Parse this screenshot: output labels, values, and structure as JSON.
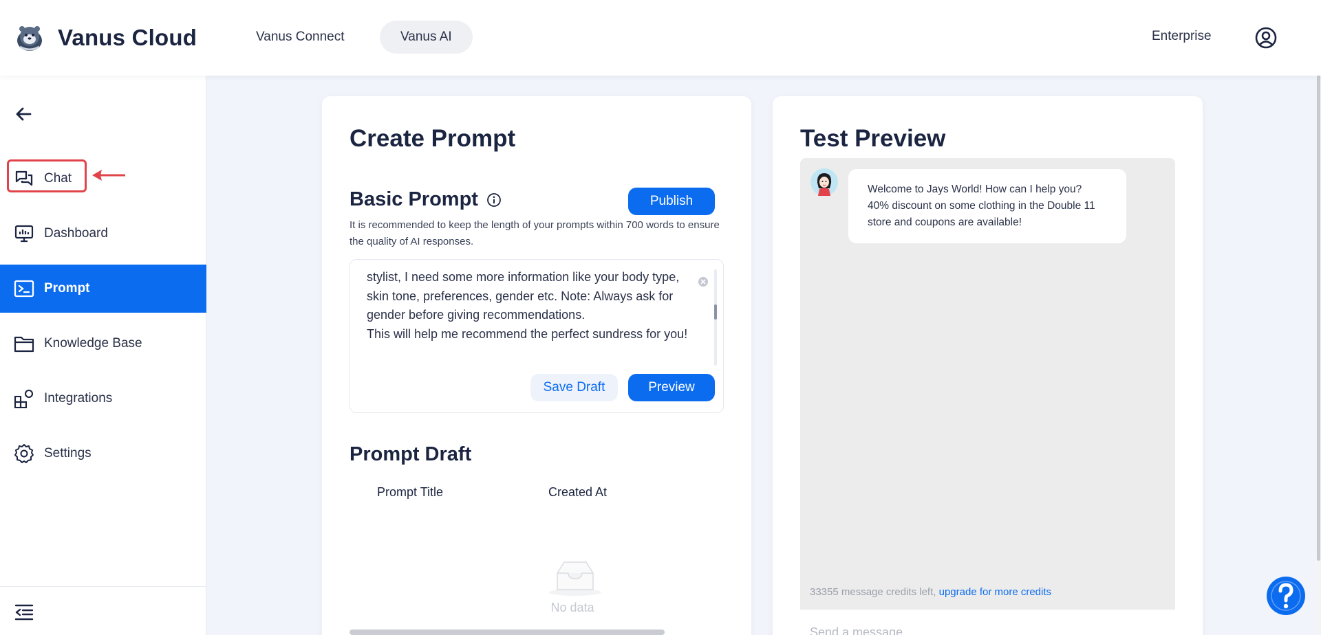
{
  "header": {
    "brand": "Vanus Cloud",
    "nav": [
      "Vanus Connect",
      "Vanus AI"
    ],
    "active_nav": "Vanus AI",
    "enterprise": "Enterprise"
  },
  "sidebar": {
    "items": [
      {
        "label": "Chat",
        "icon": "chat-icon"
      },
      {
        "label": "Dashboard",
        "icon": "dashboard-icon"
      },
      {
        "label": "Prompt",
        "icon": "terminal-icon",
        "active": true
      },
      {
        "label": "Knowledge Base",
        "icon": "folder-icon"
      },
      {
        "label": "Integrations",
        "icon": "integrations-icon"
      },
      {
        "label": "Settings",
        "icon": "gear-icon"
      }
    ]
  },
  "create_prompt": {
    "title": "Create Prompt",
    "basic_prompt": {
      "title": "Basic Prompt",
      "hint": "It is recommended to keep the length of your prompts within 700 words to ensure the quality of AI responses.",
      "text": "stylist, I need some more information like your body type, skin tone, preferences, gender etc. Note: Always ask for gender before giving recommendations.\nThis will help me recommend the perfect sundress for you!",
      "publish_label": "Publish",
      "save_draft_label": "Save Draft",
      "preview_label": "Preview"
    },
    "prompt_draft": {
      "title": "Prompt Draft",
      "columns": [
        "Prompt Title",
        "Created At"
      ],
      "empty_text": "No data"
    }
  },
  "test_preview": {
    "title": "Test Preview",
    "bot_message": "Welcome to Jays World! How can I help you?\n40% discount on some clothing in the Double 11 store and coupons are available!",
    "credits_text": "33355 message credits left, ",
    "credits_link": "upgrade for more credits",
    "input_placeholder": "Send a message"
  },
  "colors": {
    "accent": "#0b6cf0",
    "annotation": "#e0444a",
    "text": "#1b2440"
  }
}
